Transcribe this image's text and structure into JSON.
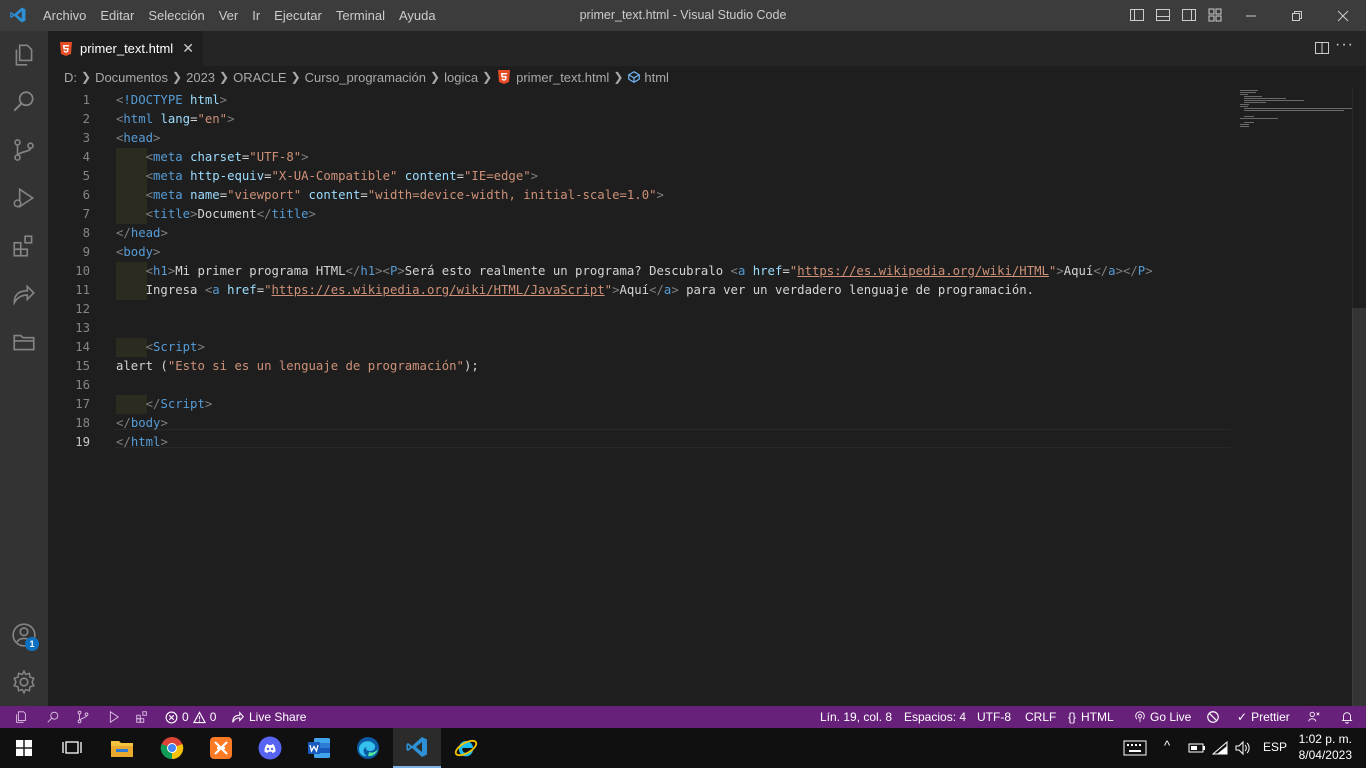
{
  "titlebar": {
    "menu": [
      "Archivo",
      "Editar",
      "Selección",
      "Ver",
      "Ir",
      "Ejecutar",
      "Terminal",
      "Ayuda"
    ],
    "window_title": "primer_text.html - Visual Studio Code"
  },
  "activity_bar": {
    "items": [
      "files-icon",
      "search-icon",
      "source-control-icon",
      "run-debug-icon",
      "extensions-icon",
      "live-share-icon",
      "remote-explorer-icon"
    ],
    "account_badge": "1"
  },
  "tabs": [
    {
      "label": "primer_text.html",
      "icon": "html5-icon",
      "close": "✕"
    }
  ],
  "breadcrumb": [
    "D:",
    "Documentos",
    "2023",
    "ORACLE",
    "Curso_programación",
    "logica",
    "primer_text.html",
    "html"
  ],
  "editor": {
    "line_numbers": [
      "1",
      "2",
      "3",
      "4",
      "5",
      "6",
      "7",
      "8",
      "9",
      "10",
      "11",
      "12",
      "13",
      "14",
      "15",
      "16",
      "17",
      "18",
      "19"
    ],
    "current_line": "19",
    "lines": [
      [
        [
          "tg",
          "<"
        ],
        [
          "t",
          "!DOCTYPE"
        ],
        [
          "tx",
          " "
        ],
        [
          "a",
          "html"
        ],
        [
          "tg",
          ">"
        ]
      ],
      [
        [
          "tg",
          "<"
        ],
        [
          "t",
          "html"
        ],
        [
          "tx",
          " "
        ],
        [
          "a",
          "lang"
        ],
        [
          "tx",
          "="
        ],
        [
          "s",
          "\"en\""
        ],
        [
          "tg",
          ">"
        ]
      ],
      [
        [
          "tg",
          "<"
        ],
        [
          "t",
          "head"
        ],
        [
          "tg",
          ">"
        ]
      ],
      [
        [
          "tx",
          "    "
        ],
        [
          "tg",
          "<"
        ],
        [
          "t",
          "meta"
        ],
        [
          "tx",
          " "
        ],
        [
          "a",
          "charset"
        ],
        [
          "tx",
          "="
        ],
        [
          "s",
          "\"UTF-8\""
        ],
        [
          "tg",
          ">"
        ]
      ],
      [
        [
          "tx",
          "    "
        ],
        [
          "tg",
          "<"
        ],
        [
          "t",
          "meta"
        ],
        [
          "tx",
          " "
        ],
        [
          "a",
          "http-equiv"
        ],
        [
          "tx",
          "="
        ],
        [
          "s",
          "\"X-UA-Compatible\""
        ],
        [
          "tx",
          " "
        ],
        [
          "a",
          "content"
        ],
        [
          "tx",
          "="
        ],
        [
          "s",
          "\"IE=edge\""
        ],
        [
          "tg",
          ">"
        ]
      ],
      [
        [
          "tx",
          "    "
        ],
        [
          "tg",
          "<"
        ],
        [
          "t",
          "meta"
        ],
        [
          "tx",
          " "
        ],
        [
          "a",
          "name"
        ],
        [
          "tx",
          "="
        ],
        [
          "s",
          "\"viewport\""
        ],
        [
          "tx",
          " "
        ],
        [
          "a",
          "content"
        ],
        [
          "tx",
          "="
        ],
        [
          "s",
          "\"width=device-width, initial-scale=1.0\""
        ],
        [
          "tg",
          ">"
        ]
      ],
      [
        [
          "tx",
          "    "
        ],
        [
          "tg",
          "<"
        ],
        [
          "t",
          "title"
        ],
        [
          "tg",
          ">"
        ],
        [
          "tx",
          "Document"
        ],
        [
          "tg",
          "</"
        ],
        [
          "t",
          "title"
        ],
        [
          "tg",
          ">"
        ]
      ],
      [
        [
          "tg",
          "</"
        ],
        [
          "t",
          "head"
        ],
        [
          "tg",
          ">"
        ]
      ],
      [
        [
          "tg",
          "<"
        ],
        [
          "t",
          "body"
        ],
        [
          "tg",
          ">"
        ]
      ],
      [
        [
          "tx",
          "    "
        ],
        [
          "tg",
          "<"
        ],
        [
          "t",
          "h1"
        ],
        [
          "tg",
          ">"
        ],
        [
          "tx",
          "Mi primer programa HTML"
        ],
        [
          "tg",
          "</"
        ],
        [
          "t",
          "h1"
        ],
        [
          "tg",
          "><"
        ],
        [
          "t",
          "P"
        ],
        [
          "tg",
          ">"
        ],
        [
          "tx",
          "Será esto realmente un programa? Descubralo "
        ],
        [
          "tg",
          "<"
        ],
        [
          "t",
          "a"
        ],
        [
          "tx",
          " "
        ],
        [
          "a",
          "href"
        ],
        [
          "tx",
          "="
        ],
        [
          "s",
          "\""
        ],
        [
          "su",
          "https://es.wikipedia.org/wiki/HTML"
        ],
        [
          "s",
          "\""
        ],
        [
          "tg",
          ">"
        ],
        [
          "tx",
          "Aquí"
        ],
        [
          "tg",
          "</"
        ],
        [
          "t",
          "a"
        ],
        [
          "tg",
          "></"
        ],
        [
          "t",
          "P"
        ],
        [
          "tg",
          ">"
        ]
      ],
      [
        [
          "tx",
          "    Ingresa "
        ],
        [
          "tg",
          "<"
        ],
        [
          "t",
          "a"
        ],
        [
          "tx",
          " "
        ],
        [
          "a",
          "href"
        ],
        [
          "tx",
          "="
        ],
        [
          "s",
          "\""
        ],
        [
          "su",
          "https://es.wikipedia.org/wiki/HTML/JavaScript"
        ],
        [
          "s",
          "\""
        ],
        [
          "tg",
          ">"
        ],
        [
          "tx",
          "Aquí"
        ],
        [
          "tg",
          "</"
        ],
        [
          "t",
          "a"
        ],
        [
          "tg",
          ">"
        ],
        [
          "tx",
          " para ver un verdadero lenguaje de programación."
        ]
      ],
      [],
      [],
      [
        [
          "tx",
          "    "
        ],
        [
          "tg",
          "<"
        ],
        [
          "t",
          "Script"
        ],
        [
          "tg",
          ">"
        ]
      ],
      [
        [
          "tx",
          "alert ("
        ],
        [
          "s",
          "\"Esto si es un lenguaje de programación\""
        ],
        [
          "tx",
          ");"
        ]
      ],
      [],
      [
        [
          "tx",
          "    "
        ],
        [
          "tg",
          "</"
        ],
        [
          "t",
          "Script"
        ],
        [
          "tg",
          ">"
        ]
      ],
      [
        [
          "tg",
          "</"
        ],
        [
          "t",
          "body"
        ],
        [
          "tg",
          ">"
        ]
      ],
      [
        [
          "tg",
          "</"
        ],
        [
          "t",
          "html"
        ],
        [
          "tg",
          ">"
        ]
      ]
    ]
  },
  "statusbar": {
    "errors": "0",
    "warnings": "0",
    "live_share": "Live Share",
    "position": "Lín. 19, col. 8",
    "spaces": "Espacios: 4",
    "encoding": "UTF-8",
    "eol": "CRLF",
    "language": "HTML",
    "go_live": "Go Live",
    "prettier": "Prettier"
  },
  "taskbar": {
    "apps": [
      "windows-start-icon",
      "task-view-icon",
      "file-explorer-icon",
      "chrome-icon",
      "xampp-icon",
      "discord-icon",
      "word-icon",
      "edge-icon",
      "vscode-icon",
      "internet-explorer-icon"
    ],
    "language": "ESP",
    "time": "1:02 p. m.",
    "date": "8/04/2023"
  },
  "colors": {
    "statusbar": "#68217a",
    "titlebar": "#3c3c3c",
    "activitybar": "#333333",
    "editor_bg": "#1e1e1e",
    "tag": "#569cd6",
    "attribute": "#9cdcfe",
    "string": "#ce9178"
  }
}
